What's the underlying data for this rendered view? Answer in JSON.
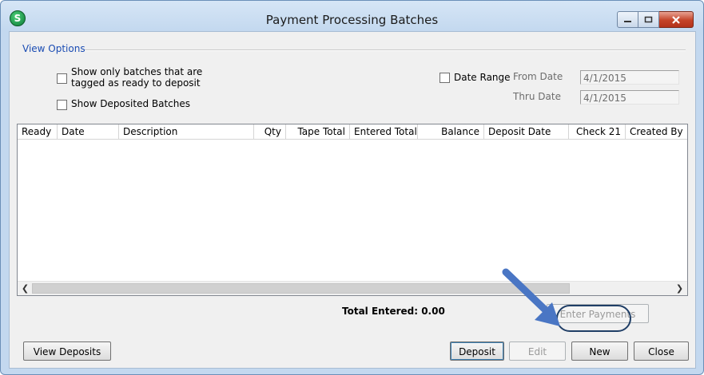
{
  "window": {
    "title": "Payment Processing Batches",
    "app_icon_letter": "S"
  },
  "view_options": {
    "label": "View Options",
    "show_ready_line1": "Show only batches that are",
    "show_ready_line2": "tagged as ready to deposit",
    "show_deposited": "Show Deposited Batches",
    "date_range": "Date Range",
    "from_label": "From Date",
    "from_value": "4/1/2015",
    "thru_label": "Thru Date",
    "thru_value": "4/1/2015"
  },
  "grid": {
    "columns": [
      "Ready",
      "Date",
      "Description",
      "Qty",
      "Tape Total",
      "Entered Total",
      "Balance",
      "Deposit Date",
      "Check 21",
      "Created By"
    ]
  },
  "total_entered": "Total Entered: 0.00",
  "buttons": {
    "enter_payments": "Enter Payments",
    "view_deposits": "View Deposits",
    "deposit": "Deposit",
    "edit": "Edit",
    "new": "New",
    "close": "Close"
  },
  "colors": {
    "annotation_arrow": "#4a76c4",
    "highlight_ring": "#1f3e66",
    "group_label": "#1a4cb3"
  }
}
